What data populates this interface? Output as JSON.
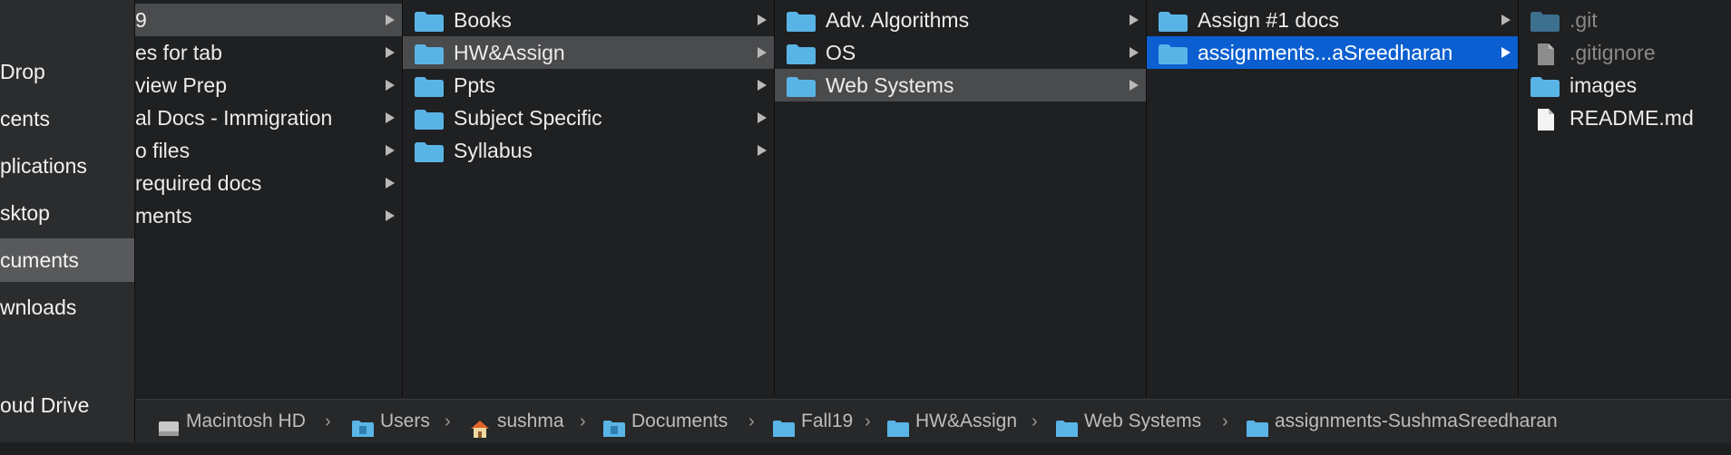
{
  "sidebar": {
    "items": [
      {
        "label": "Drop"
      },
      {
        "label": "cents"
      },
      {
        "label": "plications"
      },
      {
        "label": "sktop"
      },
      {
        "label": "cuments"
      },
      {
        "label": "wnloads"
      },
      {
        "label": "oud Drive"
      }
    ],
    "selected_index": 4
  },
  "columns": [
    {
      "rows": [
        {
          "label": "9",
          "icon": "none",
          "arrow": true
        },
        {
          "label": "es for tab",
          "icon": "none",
          "arrow": true
        },
        {
          "label": "view Prep",
          "icon": "none",
          "arrow": true
        },
        {
          "label": "al Docs - Immigration",
          "icon": "none",
          "arrow": true
        },
        {
          "label": "o files",
          "icon": "none",
          "arrow": true
        },
        {
          "label": "required docs",
          "icon": "none",
          "arrow": true
        },
        {
          "label": "ments",
          "icon": "none",
          "arrow": true
        }
      ],
      "selected_index": 0
    },
    {
      "rows": [
        {
          "label": "Books",
          "icon": "folder-icon",
          "arrow": true
        },
        {
          "label": "HW&Assign",
          "icon": "folder-icon",
          "arrow": true
        },
        {
          "label": "Ppts",
          "icon": "folder-icon",
          "arrow": true
        },
        {
          "label": "Subject Specific",
          "icon": "folder-icon",
          "arrow": true
        },
        {
          "label": "Syllabus",
          "icon": "folder-icon",
          "arrow": true
        }
      ],
      "selected_index": 1
    },
    {
      "rows": [
        {
          "label": "Adv. Algorithms",
          "icon": "folder-icon",
          "arrow": true
        },
        {
          "label": "OS",
          "icon": "folder-icon",
          "arrow": true
        },
        {
          "label": "Web Systems",
          "icon": "folder-icon",
          "arrow": true
        }
      ],
      "selected_index": 2
    },
    {
      "rows": [
        {
          "label": "Assign #1 docs",
          "icon": "folder-icon",
          "arrow": true
        },
        {
          "label": "assignments...aSreedharan",
          "icon": "folder-icon",
          "arrow": true
        }
      ],
      "selected_index": 1
    },
    {
      "rows": [
        {
          "label": ".git",
          "icon": "folder-icon",
          "arrow": false,
          "hidden_file": true
        },
        {
          "label": ".gitignore",
          "icon": "file-icon",
          "arrow": false,
          "hidden_file": true
        },
        {
          "label": "images",
          "icon": "folder-icon",
          "arrow": false
        },
        {
          "label": "README.md",
          "icon": "file-icon",
          "arrow": false
        }
      ],
      "selected_index": -1
    }
  ],
  "pathbar": {
    "crumbs": [
      {
        "label": "Macintosh HD",
        "icon": "hard-drive-icon"
      },
      {
        "label": "Users",
        "icon": "users-folder-icon"
      },
      {
        "label": "sushma",
        "icon": "home-icon"
      },
      {
        "label": "Documents",
        "icon": "documents-folder-icon"
      },
      {
        "label": "Fall19",
        "icon": "folder-icon"
      },
      {
        "label": "HW&Assign",
        "icon": "folder-icon"
      },
      {
        "label": "Web Systems",
        "icon": "folder-icon"
      },
      {
        "label": "assignments-SushmaSreedharan",
        "icon": "folder-icon"
      }
    ],
    "separator": "›"
  },
  "colors": {
    "folder": "#5ab4e6",
    "selection_blue": "#0b5fd0",
    "selection_gray": "#4a4b4d"
  }
}
